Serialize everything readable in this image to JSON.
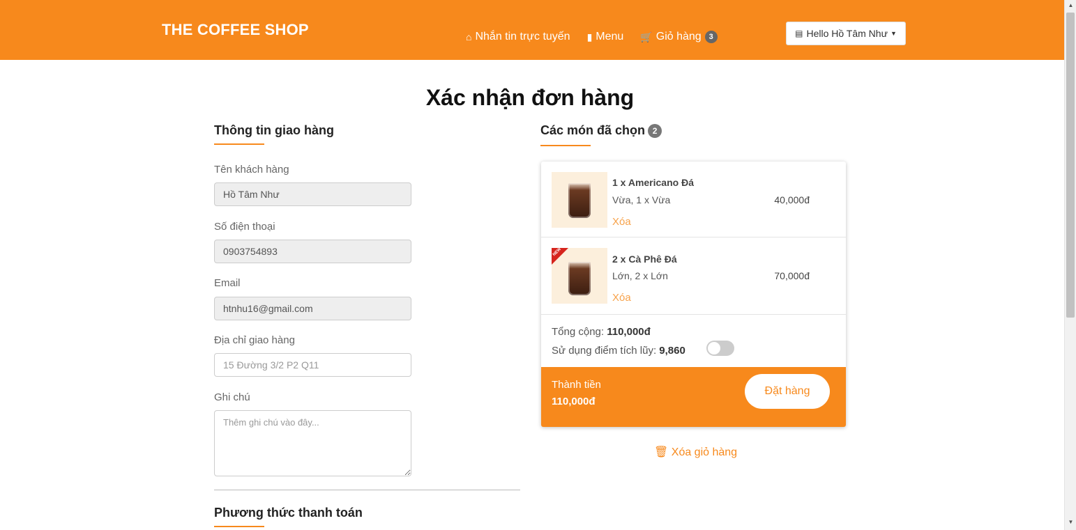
{
  "navbar": {
    "brand": "THE COFFEE SHOP",
    "links": [
      {
        "icon": "home-icon",
        "label": "Nhắn tin trực tuyến"
      },
      {
        "icon": "book-icon",
        "label": "Menu"
      },
      {
        "icon": "cart-icon",
        "label": "Giỏ hàng",
        "badge": "3"
      }
    ],
    "user_label": "Hello Hồ Tâm Như",
    "user_icon": "id-card-icon"
  },
  "page_title": "Xác nhận đơn hàng",
  "shipping": {
    "title": "Thông tin giao hàng",
    "fields": [
      {
        "label": "Tên khách hàng",
        "value": "Hồ Tâm Như",
        "readonly": true
      },
      {
        "label": "Số điện thoại",
        "value": "0903754893",
        "readonly": true
      },
      {
        "label": "Email",
        "value": "htnhu16@gmail.com",
        "readonly": true
      },
      {
        "label": "Địa chỉ giao hàng",
        "placeholder": "15 Đường 3/2 P2 Q11"
      }
    ],
    "note_label": "Ghi chú",
    "note_placeholder": "Thêm ghi chú vào đây...",
    "payment_title": "Phương thức thanh toán"
  },
  "order": {
    "title": "Các món đã chọn",
    "count": "2",
    "items": [
      {
        "name": "1 x Americano Đá",
        "options": "Vừa, 1 x Vừa",
        "price": "40,000đ",
        "remove": "Xóa"
      },
      {
        "name": "2 x Cà Phê Đá",
        "options": "Lớn, 2 x Lớn",
        "price": "70,000đ",
        "remove": "Xóa",
        "badge": "NEW"
      }
    ],
    "subtotal_label": "Tổng cộng:",
    "subtotal_value": "110,000đ",
    "points_label": "Sử dụng điểm tích lũy:",
    "points_value": "9,860",
    "total_label": "Thành tiền",
    "total_value": "110,000đ",
    "order_button": "Đặt hàng",
    "clear_cart": "Xóa giỏ hàng"
  },
  "colors": {
    "accent": "#f7891c",
    "badge": "#666666"
  }
}
